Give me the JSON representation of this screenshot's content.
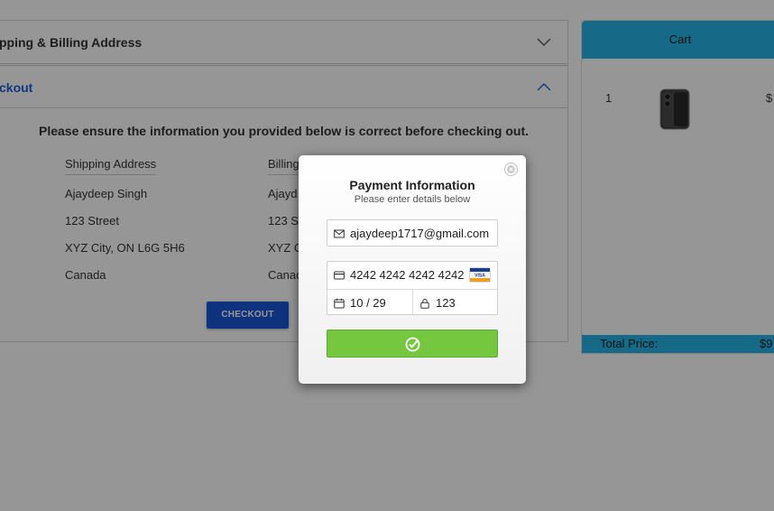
{
  "accordion": {
    "section1_title": "pping & Billing Address",
    "section2_title": "ckout",
    "notice": "Please ensure the information you provided below is correct before checking out.",
    "shipping": {
      "heading": "Shipping Address",
      "name": "Ajaydeep Singh",
      "street": "123 Street",
      "city": "XYZ City, ON L6G 5H6",
      "country": "Canada"
    },
    "billing": {
      "heading": "Billing",
      "name": "Ajayd",
      "street": "123 S",
      "city": "XYZ C",
      "country": "Canac"
    },
    "checkout_label": "CHECKOUT"
  },
  "cart": {
    "title": "Cart",
    "item_qty": "1",
    "item_price_partial": "$",
    "total_label": "Total Price:",
    "total_value_partial": "$9"
  },
  "modal": {
    "title": "Payment Information",
    "subtitle": "Please enter details below",
    "email": "ajaydeep1717@gmail.com",
    "card_number": "4242 4242 4242 4242",
    "expiry": "10 / 29",
    "cvc": "123",
    "visa_text": "VISA"
  },
  "colors": {
    "accent_blue": "#1a56d8",
    "cart_header": "#27b4e6",
    "pay_green": "#76c740"
  }
}
